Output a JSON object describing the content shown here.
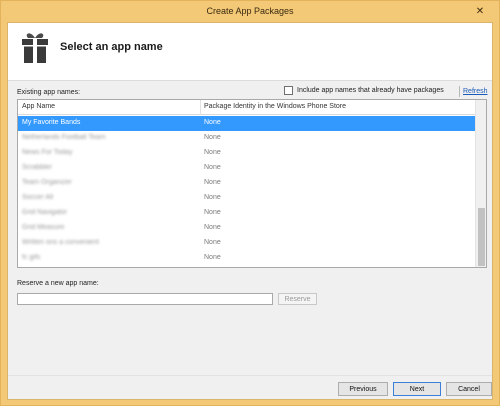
{
  "window": {
    "title": "Create App Packages",
    "close_glyph": "✕"
  },
  "header": {
    "title": "Select an app name",
    "icon": "gift-package-icon"
  },
  "existing": {
    "label": "Existing app names:",
    "include_label": "Include app names that already have packages",
    "include_checked": false,
    "refresh_label": "Refresh"
  },
  "list": {
    "columns": [
      "App Name",
      "Package Identity in the Windows Phone Store"
    ],
    "rows": [
      {
        "name": "My Favorite Bands",
        "package": "None"
      },
      {
        "name": "Netherlands Football Team",
        "package": "None"
      },
      {
        "name": "News For Today",
        "package": "None"
      },
      {
        "name": "Scrabbler",
        "package": "None"
      },
      {
        "name": "Team Organizer",
        "package": "None"
      },
      {
        "name": "Soccer All",
        "package": "None"
      },
      {
        "name": "Grid Navigator",
        "package": "None"
      },
      {
        "name": "Grid Measure",
        "package": "None"
      },
      {
        "name": "Written ons a convenient",
        "package": "None"
      },
      {
        "name": "fc gifs",
        "package": "None"
      }
    ],
    "selected_index": 0,
    "scroll_position": 0.65
  },
  "reserve": {
    "label": "Reserve a new app name:",
    "value": "",
    "button_label": "Reserve"
  },
  "footer": {
    "previous_label": "Previous",
    "next_label": "Next",
    "cancel_label": "Cancel"
  },
  "colors": {
    "title_bar": "#f3c977",
    "selection": "#3399ff",
    "link": "#1a5bb8"
  }
}
